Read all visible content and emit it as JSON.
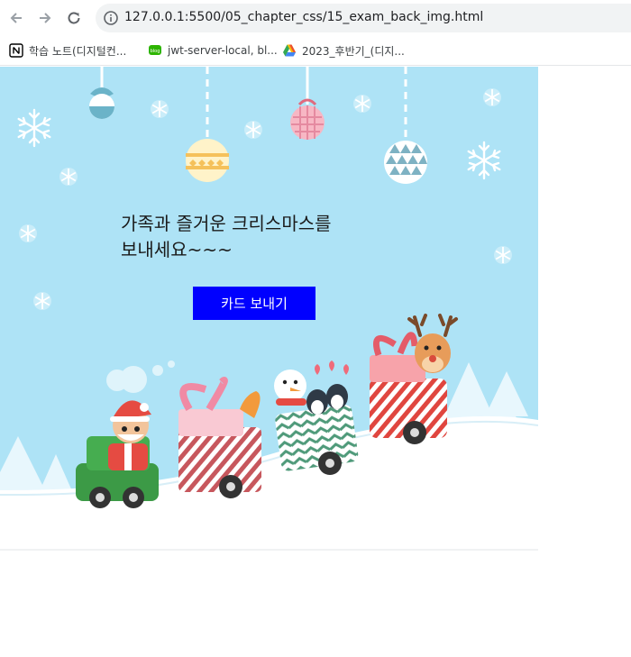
{
  "browser": {
    "url": "127.0.0.1:5500/05_chapter_css/15_exam_back_img.html",
    "bookmarks": [
      {
        "label": "학습 노트(디지털컨...",
        "icon": "notion-icon"
      },
      {
        "label": "jwt-server-local, bl...",
        "icon": "blog-icon"
      },
      {
        "label": "2023_후반기_(디지...",
        "icon": "google-drive-icon"
      }
    ]
  },
  "card": {
    "message_line1": "가족과 즐거운 크리스마스를",
    "message_line2": "보내세요~~~",
    "button_label": "카드 보내기",
    "colors": {
      "sky": "#aee3f6",
      "button": "#0000ff",
      "snow": "#ffffff"
    }
  }
}
